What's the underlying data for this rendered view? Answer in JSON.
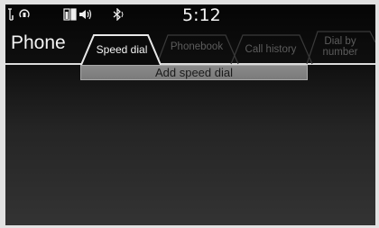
{
  "status": {
    "signal_icon": "signal-antenna-icon",
    "phone_icon": "hfl-phone-icon",
    "battery_icon": "phone-battery-icon",
    "audio_icon": "audio-streaming-icon",
    "bluetooth_icon": "bluetooth-icon",
    "time": "5:12"
  },
  "header": {
    "title": "Phone"
  },
  "tabs": [
    {
      "label": "Speed dial",
      "active": true
    },
    {
      "label": "Phonebook",
      "active": false
    },
    {
      "label": "Call history",
      "active": false
    },
    {
      "label": "Dial by number",
      "active": false
    }
  ],
  "list": {
    "items": [
      {
        "label": "Add speed dial"
      }
    ]
  },
  "colors": {
    "background": "#0b0b0b",
    "text": "#f2f2f2",
    "inactive_tab": "#5c5c5c",
    "item": "#808080"
  }
}
